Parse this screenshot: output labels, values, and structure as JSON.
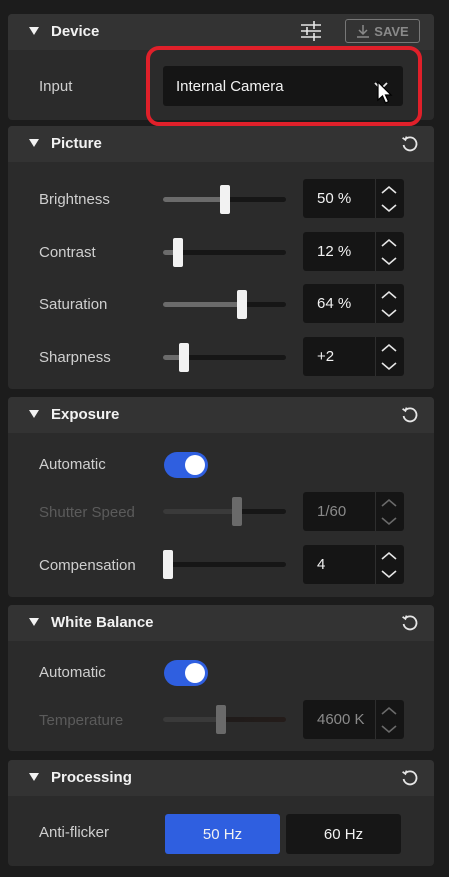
{
  "device": {
    "title": "Device",
    "save_label": "SAVE",
    "input_label": "Input",
    "input_value": "Internal Camera"
  },
  "picture": {
    "title": "Picture",
    "brightness": {
      "label": "Brightness",
      "value": "50 %",
      "level": 0.5
    },
    "contrast": {
      "label": "Contrast",
      "value": "12 %",
      "level": 0.12
    },
    "saturation": {
      "label": "Saturation",
      "value": "64 %",
      "level": 0.64
    },
    "sharpness": {
      "label": "Sharpness",
      "value": "+2",
      "level": 0.17
    }
  },
  "exposure": {
    "title": "Exposure",
    "automatic_label": "Automatic",
    "automatic_on": true,
    "shutter": {
      "label": "Shutter Speed",
      "value": "1/60",
      "level": 0.6,
      "disabled": true
    },
    "compensation": {
      "label": "Compensation",
      "value": "4",
      "level": 0.0
    }
  },
  "white_balance": {
    "title": "White Balance",
    "automatic_label": "Automatic",
    "automatic_on": true,
    "temperature": {
      "label": "Temperature",
      "value": "4600 K",
      "level": 0.47,
      "disabled": true
    }
  },
  "processing": {
    "title": "Processing",
    "antiflicker_label": "Anti-flicker",
    "options": [
      "50 Hz",
      "60 Hz"
    ],
    "selected": "50 Hz"
  },
  "colors": {
    "accent": "#2f5fe0",
    "highlight": "#e0202a"
  }
}
